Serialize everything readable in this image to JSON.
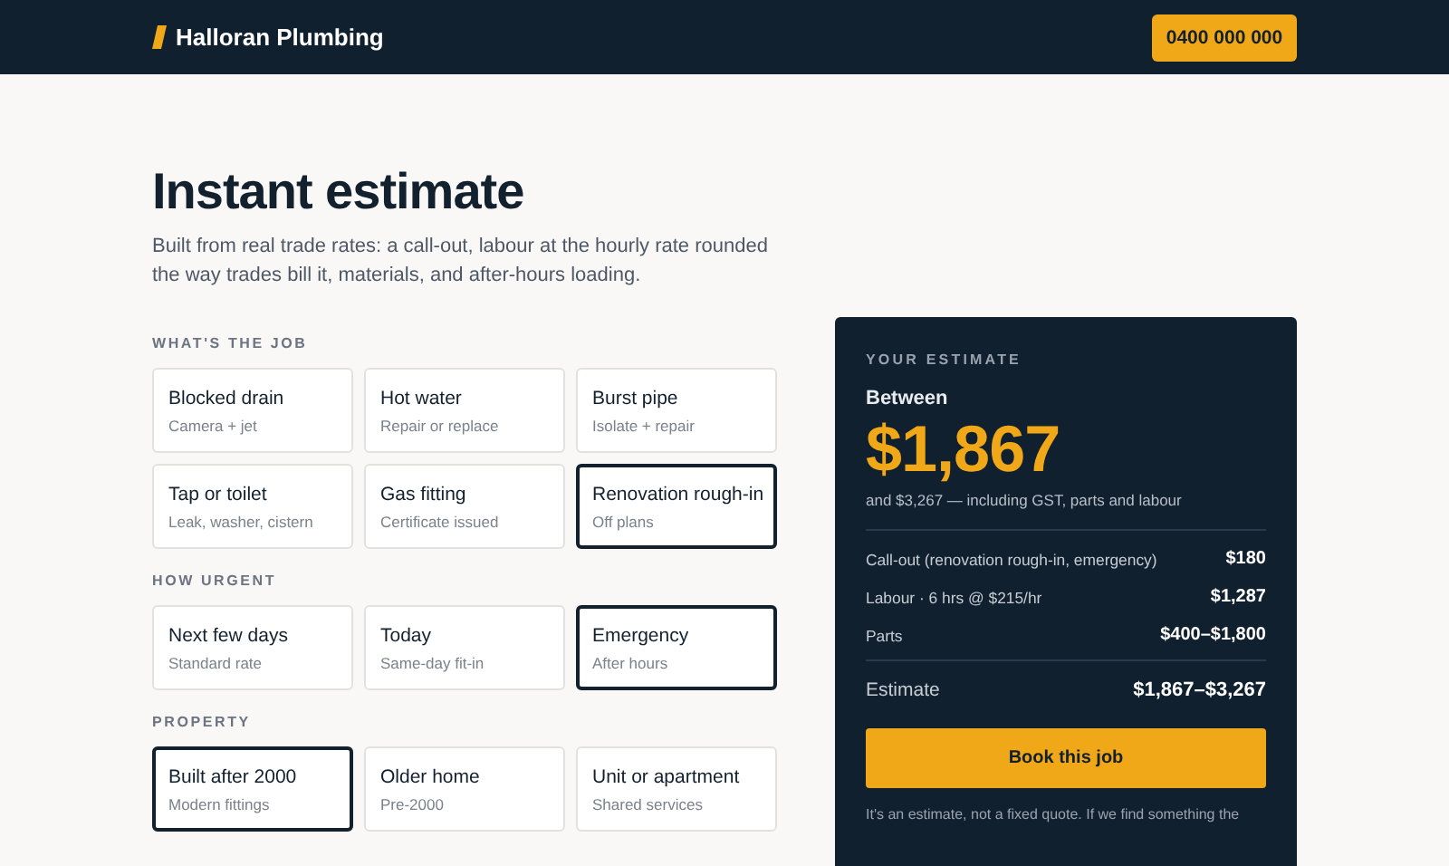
{
  "header": {
    "brand": "Halloran Plumbing",
    "phone": "0400 000 000"
  },
  "intro": {
    "title": "Instant estimate",
    "description": "Built from real trade rates: a call-out, labour at the hourly rate rounded the way trades bill it, materials, and after-hours loading."
  },
  "sections": [
    {
      "heading": "WHAT'S THE JOB",
      "options": [
        {
          "label": "Blocked drain",
          "detail": "Camera + jet",
          "selected": false
        },
        {
          "label": "Hot water",
          "detail": "Repair or replace",
          "selected": false
        },
        {
          "label": "Burst pipe",
          "detail": "Isolate + repair",
          "selected": false
        },
        {
          "label": "Tap or toilet",
          "detail": "Leak, washer, cistern",
          "selected": false
        },
        {
          "label": "Gas fitting",
          "detail": "Certificate issued",
          "selected": false
        },
        {
          "label": "Renovation rough-in",
          "detail": "Off plans",
          "selected": true
        }
      ]
    },
    {
      "heading": "HOW URGENT",
      "options": [
        {
          "label": "Next few days",
          "detail": "Standard rate",
          "selected": false
        },
        {
          "label": "Today",
          "detail": "Same-day fit-in",
          "selected": false
        },
        {
          "label": "Emergency",
          "detail": "After hours",
          "selected": true
        }
      ]
    },
    {
      "heading": "PROPERTY",
      "options": [
        {
          "label": "Built after 2000",
          "detail": "Modern fittings",
          "selected": true
        },
        {
          "label": "Older home",
          "detail": "Pre-2000",
          "selected": false
        },
        {
          "label": "Unit or apartment",
          "detail": "Shared services",
          "selected": false
        }
      ]
    }
  ],
  "estimate": {
    "heading": "YOUR ESTIMATE",
    "lead": "Between",
    "amount": "$1,867",
    "range_note": "and $3,267 — including GST, parts and labour",
    "lines": [
      {
        "label": "Call-out (renovation rough-in, emergency)",
        "value": "$180"
      },
      {
        "label": "Labour · 6 hrs @ $215/hr",
        "value": "$1,287"
      },
      {
        "label": "Parts",
        "value": "$400–$1,800"
      }
    ],
    "total": {
      "label": "Estimate",
      "value": "$1,867–$3,267"
    },
    "button": "Book this job",
    "note": "It's an estimate, not a fixed quote. If we find something the"
  }
}
